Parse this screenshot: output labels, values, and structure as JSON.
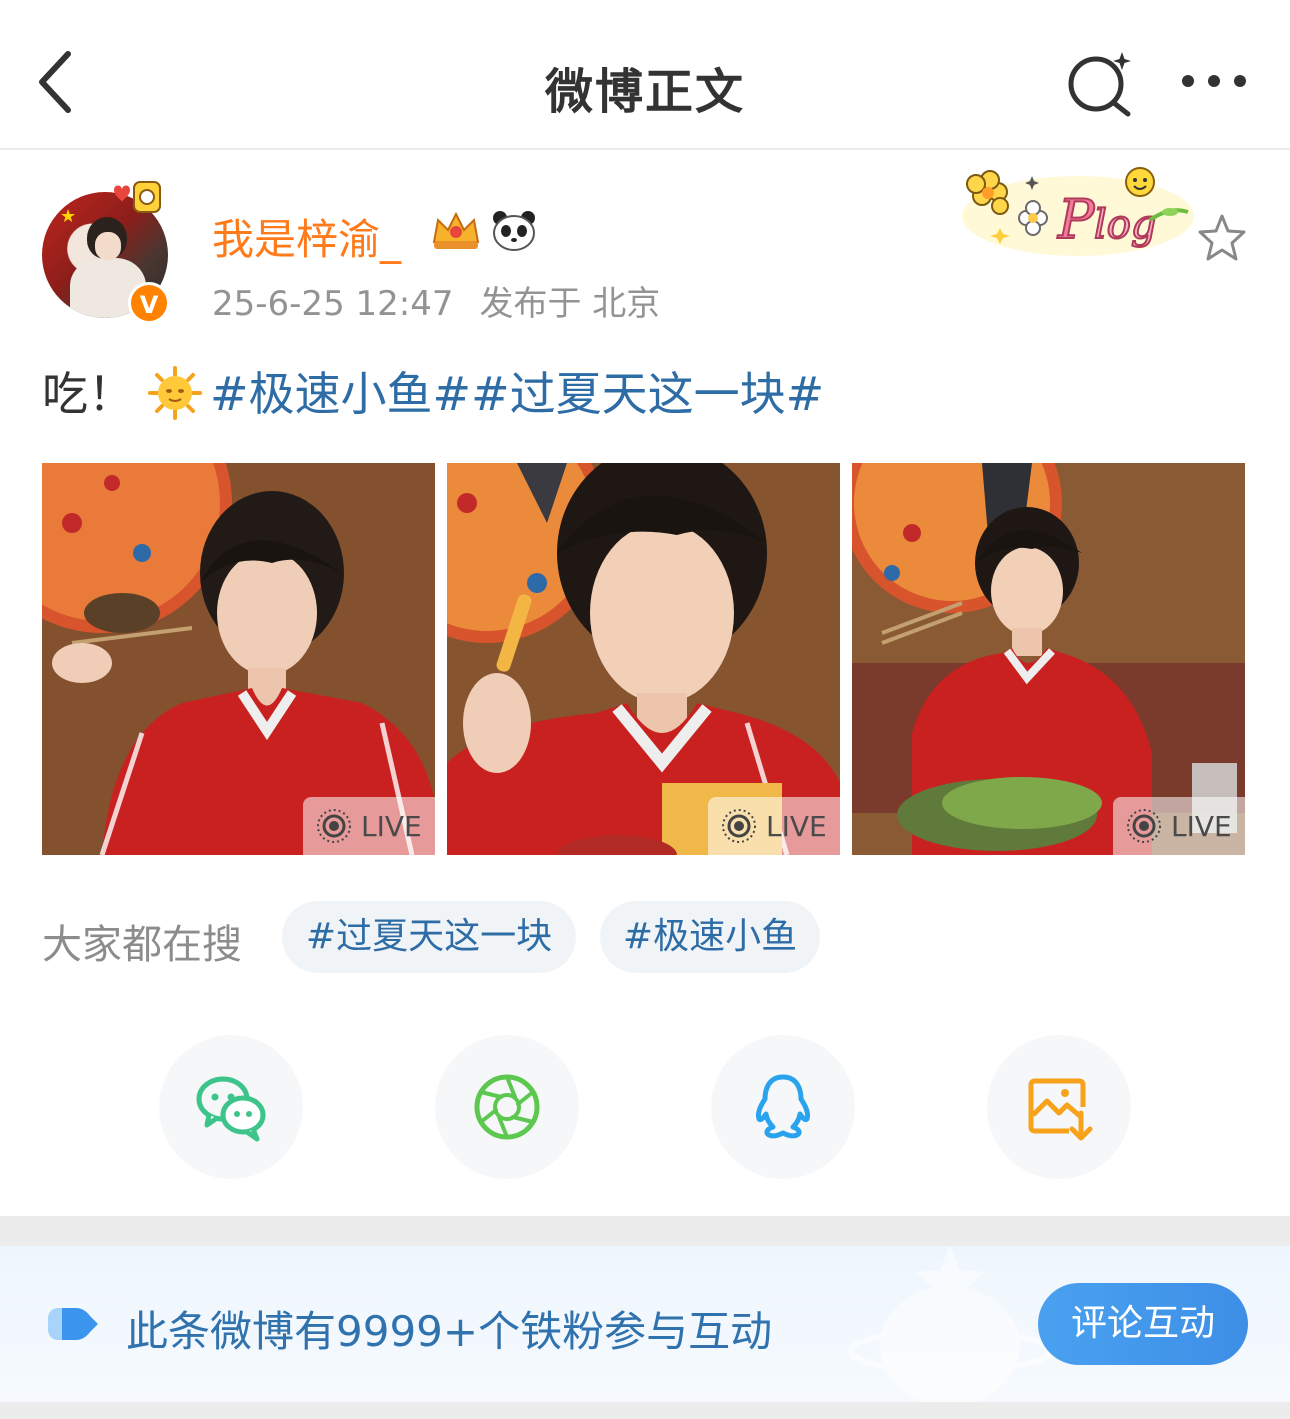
{
  "header": {
    "title": "微博正文",
    "back_icon": "chevron-left-icon",
    "search_icon": "ai-search-icon",
    "more_icon": "more-dots-icon"
  },
  "post": {
    "author": "我是梓渝_",
    "verified_badge": "V",
    "date": "25-6-25 12:47",
    "location": "发布于 北京",
    "decor_badge": "Plog",
    "text_prefix": "吃！",
    "topics": [
      "#极速小鱼#",
      "#过夏天这一块#"
    ],
    "images": [
      {
        "badge": "LIVE"
      },
      {
        "badge": "LIVE"
      },
      {
        "badge": "LIVE"
      }
    ]
  },
  "hot_search": {
    "label": "大家都在搜",
    "tags": [
      "#过夏天这一块",
      "#极速小鱼"
    ]
  },
  "share": [
    {
      "icon": "wechat-icon",
      "color": "#3cc48a"
    },
    {
      "icon": "moments-icon",
      "color": "#5cc84f"
    },
    {
      "icon": "qq-icon",
      "color": "#2aa3ef"
    },
    {
      "icon": "save-image-icon",
      "color": "#f7a21b"
    }
  ],
  "fan_banner": {
    "text": "此条微博有9999+个铁粉参与互动",
    "button": "评论互动"
  },
  "colors": {
    "username": "#ff7a1a",
    "topic": "#2e6ca6",
    "accent_blue": "#3d8fe6"
  }
}
